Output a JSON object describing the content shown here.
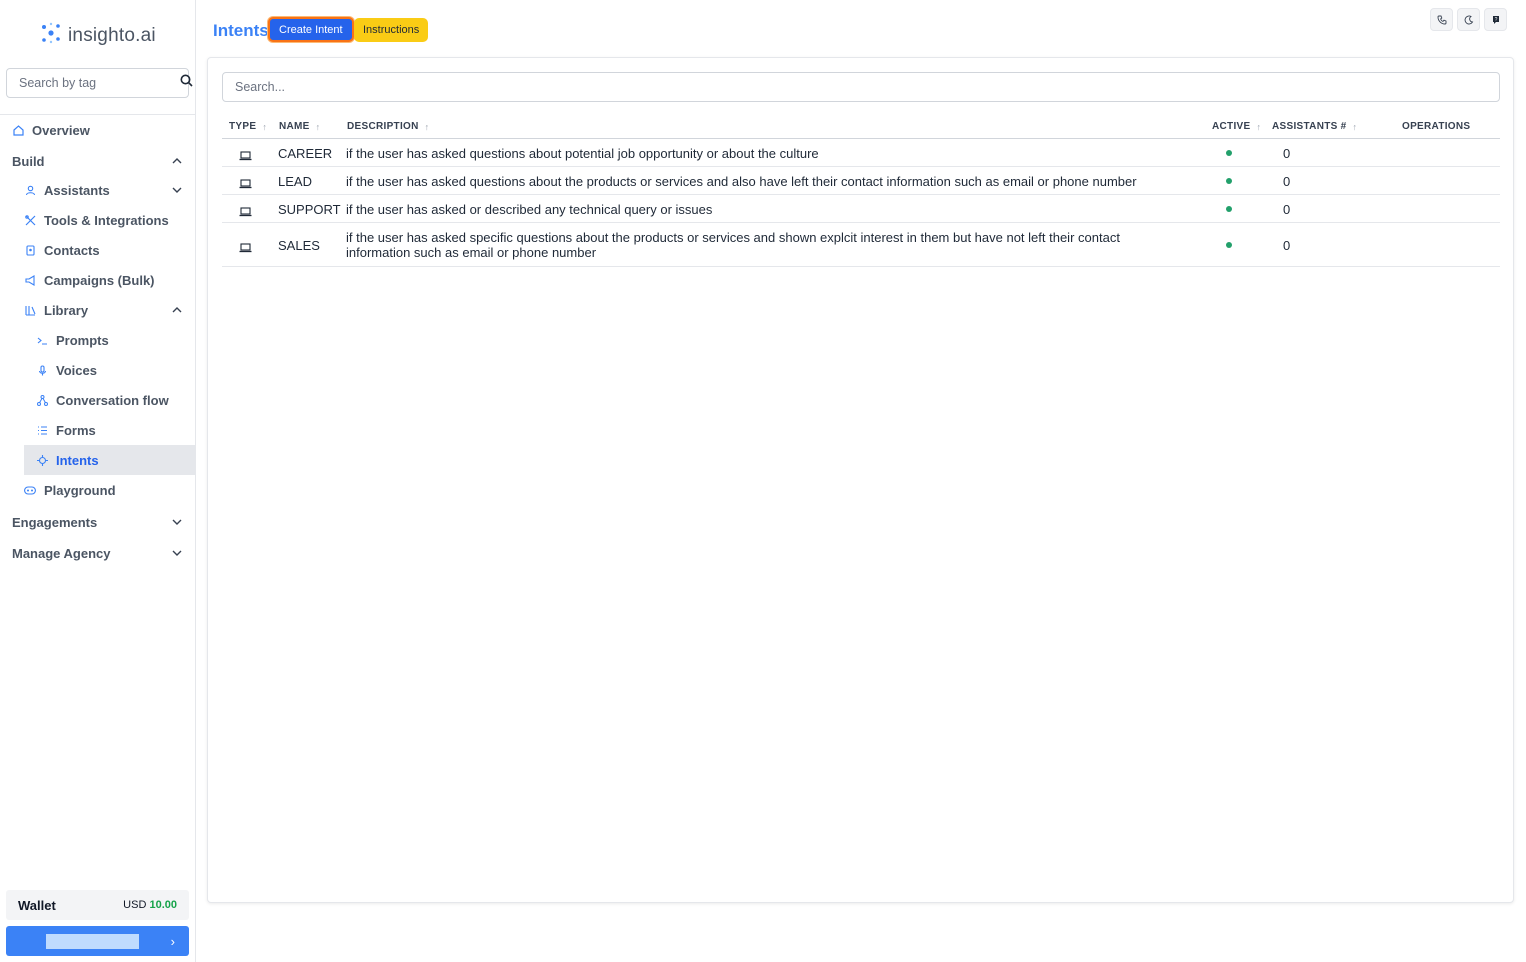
{
  "brand": {
    "name": "insighto.ai"
  },
  "sidebar": {
    "search_placeholder": "Search by tag",
    "overview": "Overview",
    "build": "Build",
    "assistants": "Assistants",
    "tools": "Tools & Integrations",
    "contacts": "Contacts",
    "campaigns": "Campaigns (Bulk)",
    "library": "Library",
    "prompts": "Prompts",
    "voices": "Voices",
    "conversation_flow": "Conversation flow",
    "forms": "Forms",
    "intents": "Intents",
    "playground": "Playground",
    "engagements": "Engagements",
    "manage_agency": "Manage Agency",
    "wallet_label": "Wallet",
    "wallet_currency": "USD",
    "wallet_amount": "10.00"
  },
  "header": {
    "title": "Intents",
    "create_button": "Create Intent",
    "instructions_button": "Instructions"
  },
  "table": {
    "search_placeholder": "Search...",
    "columns": {
      "type": "TYPE",
      "name": "NAME",
      "description": "DESCRIPTION",
      "active": "ACTIVE",
      "assistants": "ASSISTANTS #",
      "operations": "OPERATIONS"
    },
    "rows": [
      {
        "name": "CAREER",
        "description": "if the user has asked questions about potential job opportunity or about the culture",
        "active": true,
        "assistants": "0"
      },
      {
        "name": "LEAD",
        "description": "if the user has asked questions about the products or services and also have left their contact information such as email or phone number",
        "active": true,
        "assistants": "0"
      },
      {
        "name": "SUPPORT",
        "description": "if the user has asked or described any technical query or issues",
        "active": true,
        "assistants": "0"
      },
      {
        "name": "SALES",
        "description": "if the user has asked specific questions about the products or services and shown explcit interest in them but have not left their contact information such as email or phone number",
        "active": true,
        "assistants": "0"
      }
    ]
  },
  "colors": {
    "primary": "#3b82f6",
    "highlight": "#f97316",
    "instructions": "#facc15",
    "active_dot": "#22a06b"
  }
}
